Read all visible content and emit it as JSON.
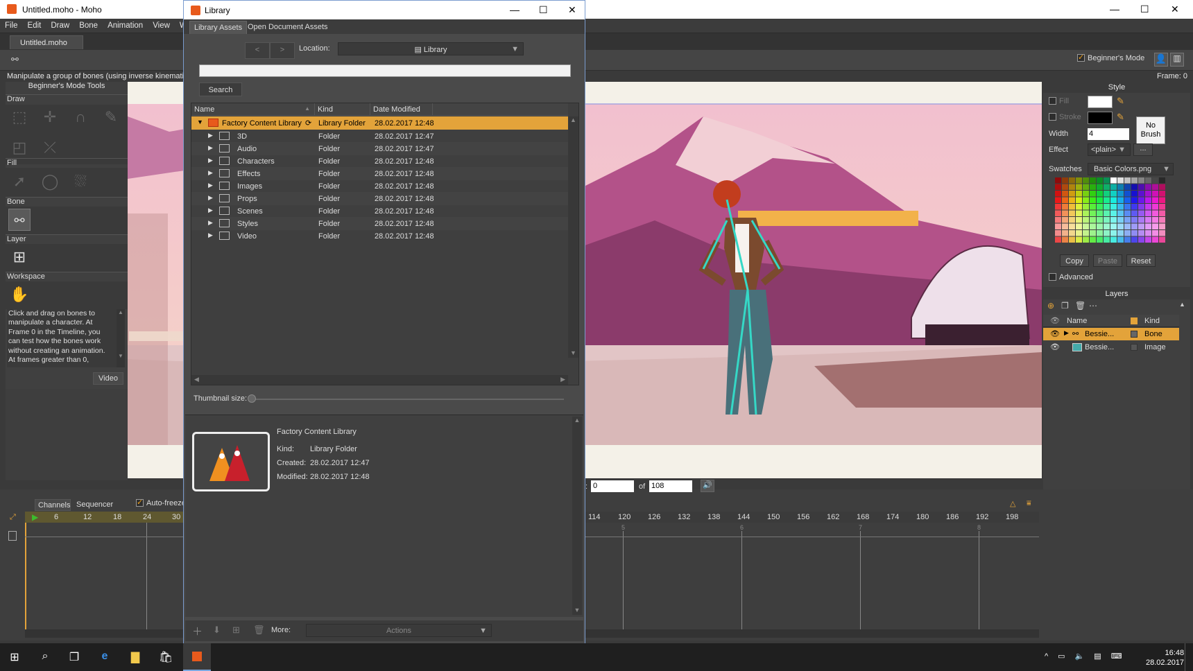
{
  "main": {
    "title": "Untitled.moho - Moho",
    "menu": [
      "File",
      "Edit",
      "Draw",
      "Bone",
      "Animation",
      "View",
      "W"
    ],
    "doc_tab": "Untitled.moho",
    "status_text": "Manipulate a group of bones (using inverse kinemati",
    "frame_label": "Frame: 0",
    "beginner_mode": "Beginner's Mode"
  },
  "tools": {
    "header": "Beginner's Mode Tools",
    "sections": {
      "draw": "Draw",
      "fill": "Fill",
      "bone": "Bone",
      "layer": "Layer",
      "workspace": "Workspace"
    },
    "help": [
      "Click and drag on bones to",
      "manipulate a character. At",
      "Frame 0 in the Timeline, you",
      "can test how the bones work",
      "without creating an animation.",
      "At frames greater than 0,"
    ],
    "video_btn": "Video"
  },
  "style": {
    "header": "Style",
    "fill": "Fill",
    "stroke": "Stroke",
    "width_label": "Width",
    "width_value": "4",
    "effect_label": "Effect",
    "effect_value": "<plain>",
    "effect_more": "...",
    "no_brush": [
      "No",
      "Brush"
    ],
    "swatches_label": "Swatches",
    "swatches_value": "Basic Colors.png",
    "copy": "Copy",
    "paste": "Paste",
    "reset": "Reset",
    "advanced": "Advanced"
  },
  "layers": {
    "header": "Layers",
    "cols": {
      "name": "Name",
      "kind": "Kind"
    },
    "rows": [
      {
        "name": "Bessie...",
        "kind": "Bone"
      },
      {
        "name": "Bessie...",
        "kind": "Image"
      }
    ]
  },
  "timeline": {
    "tabs": [
      "Channels",
      "Sequencer"
    ],
    "autofreeze": "Auto-freeze",
    "ticks_left": [
      "6",
      "12",
      "18",
      "24",
      "30"
    ],
    "ticks_right": [
      "114",
      "120",
      "126",
      "132",
      "138",
      "144",
      "150",
      "156",
      "162",
      "168",
      "174",
      "180",
      "186",
      "192",
      "198"
    ],
    "sub_ticks": [
      "5",
      "6",
      "7",
      "8"
    ],
    "frame_value": "0",
    "of_label": "of",
    "of_value": "108"
  },
  "library": {
    "title": "Library",
    "tabs": [
      "Library Assets",
      "Open Document Assets"
    ],
    "location_label": "Location:",
    "location_value": "Library",
    "search_btn": "Search",
    "search_value": "",
    "columns": {
      "name": "Name",
      "kind": "Kind",
      "date": "Date Modified"
    },
    "root": {
      "name": "Factory Content Library",
      "kind": "Library Folder",
      "date": "28.02.2017 12:48"
    },
    "rows": [
      {
        "name": "3D",
        "kind": "Folder",
        "date": "28.02.2017 12:47"
      },
      {
        "name": "Audio",
        "kind": "Folder",
        "date": "28.02.2017 12:47"
      },
      {
        "name": "Characters",
        "kind": "Folder",
        "date": "28.02.2017 12:48"
      },
      {
        "name": "Effects",
        "kind": "Folder",
        "date": "28.02.2017 12:48"
      },
      {
        "name": "Images",
        "kind": "Folder",
        "date": "28.02.2017 12:48"
      },
      {
        "name": "Props",
        "kind": "Folder",
        "date": "28.02.2017 12:48"
      },
      {
        "name": "Scenes",
        "kind": "Folder",
        "date": "28.02.2017 12:48"
      },
      {
        "name": "Styles",
        "kind": "Folder",
        "date": "28.02.2017 12:48"
      },
      {
        "name": "Video",
        "kind": "Folder",
        "date": "28.02.2017 12:48"
      }
    ],
    "thumb_label": "Thumbnail size:",
    "detail": {
      "title": "Factory Content Library",
      "kind_label": "Kind:",
      "kind": "Library Folder",
      "created_label": "Created:",
      "created": "28.02.2017 12:47",
      "modified_label": "Modified:",
      "modified": "28.02.2017 12:48"
    },
    "more_label": "More:",
    "actions": "Actions"
  },
  "taskbar": {
    "time": "16:48",
    "date": "28.02.2017"
  },
  "colors": {
    "accent": "#e3a33a",
    "panel": "#404040",
    "canvas_sky": "#e8a6be",
    "mountain": "#b04e86"
  }
}
